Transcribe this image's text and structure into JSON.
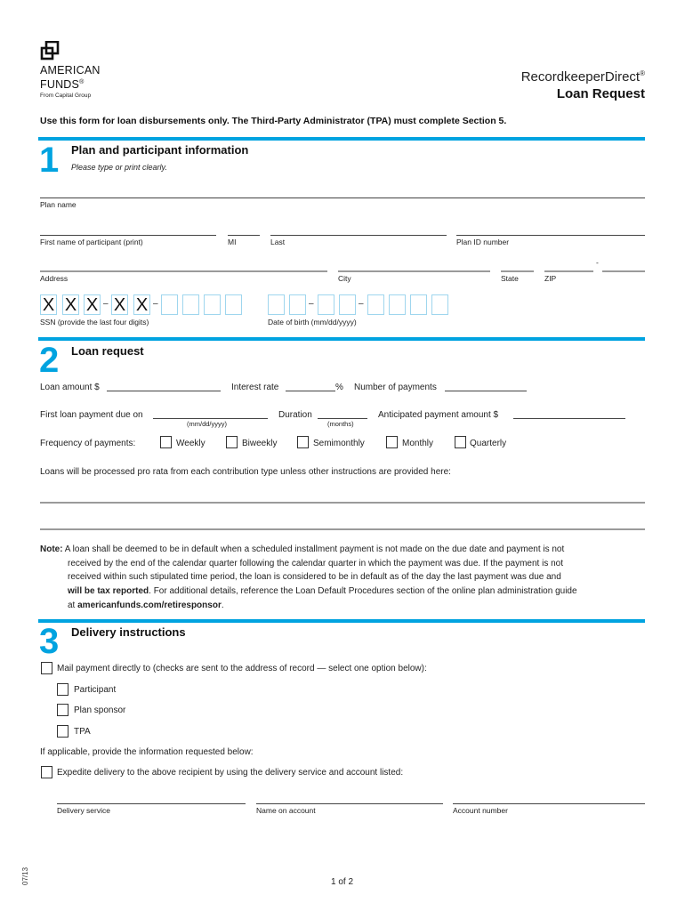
{
  "header": {
    "logo_icon": "american-funds-logo-icon",
    "logo_line1": "AMERICAN",
    "logo_line2": "FUNDS",
    "logo_reg": "®",
    "logo_sub": "From Capital Group",
    "brand": "RecordkeeperDirect",
    "brand_reg": "®",
    "title": "Loan Request"
  },
  "intro": "Use this form for loan disbursements only. The Third-Party Administrator (TPA) must complete Section 5.",
  "accent_color": "#00a3e0",
  "section1": {
    "number": "1",
    "title": "Plan and participant information",
    "subtitle": "Please type or print clearly.",
    "labels": {
      "plan_name": "Plan name",
      "first_name": "First name of participant (print)",
      "mi": "MI",
      "last": "Last",
      "plan_id": "Plan ID number",
      "address": "Address",
      "city": "City",
      "state": "State",
      "zip": "ZIP",
      "zip_dash": "-",
      "ssn": "SSN (provide the last four digits)",
      "dob": "Date of birth (mm/dd/yyyy)"
    },
    "ssn_boxes": [
      "X",
      "X",
      "X",
      "X",
      "X",
      "",
      "",
      "",
      ""
    ],
    "dob_boxes": [
      "",
      "",
      "",
      "",
      "",
      "",
      "",
      ""
    ],
    "dash": "–"
  },
  "section2": {
    "number": "2",
    "title": "Loan request",
    "loan_amount": "Loan amount $",
    "interest_rate": "Interest rate",
    "percent": "%",
    "num_payments": "Number of payments",
    "first_payment": "First loan payment due on",
    "date_hint": "(mm/dd/yyyy)",
    "duration": "Duration",
    "months_hint": "(months)",
    "anticipated": "Anticipated payment amount $",
    "frequency_label": "Frequency of payments:",
    "frequency_options": [
      "Weekly",
      "Biweekly",
      "Semimonthly",
      "Monthly",
      "Quarterly"
    ],
    "pro_rata": "Loans will be processed pro rata from each contribution type unless other instructions are provided here:"
  },
  "note": {
    "label": "Note:",
    "text1": " A loan shall be deemed to be in default when a scheduled installment payment is not made on the due date and payment is not",
    "text2": "received by the end of the calendar quarter following the calendar quarter in which the payment was due. If the payment is not",
    "text3": "received within such stipulated time period, the loan is considered to be in default as of the day the last payment was due and",
    "bold1": "will be tax reported",
    "text4": ". For additional details, reference the Loan Default Procedures section of the online plan administration guide",
    "text5": "at ",
    "link": "americanfunds.com/retiresponsor",
    "text6": "."
  },
  "section3": {
    "number": "3",
    "title": "Delivery instructions",
    "mail_option": "Mail payment directly to (checks are sent to the address of record — select one option below):",
    "recipients": [
      "Participant",
      "Plan sponsor",
      "TPA"
    ],
    "if_applicable": "If applicable, provide the information requested below:",
    "expedite_option": "Expedite delivery to the above recipient by using the delivery service and account listed:",
    "delivery_service": "Delivery service",
    "name_on_account": "Name on account",
    "account_number": "Account number"
  },
  "footer": {
    "date_code": "07/13",
    "page": "1 of 2"
  }
}
